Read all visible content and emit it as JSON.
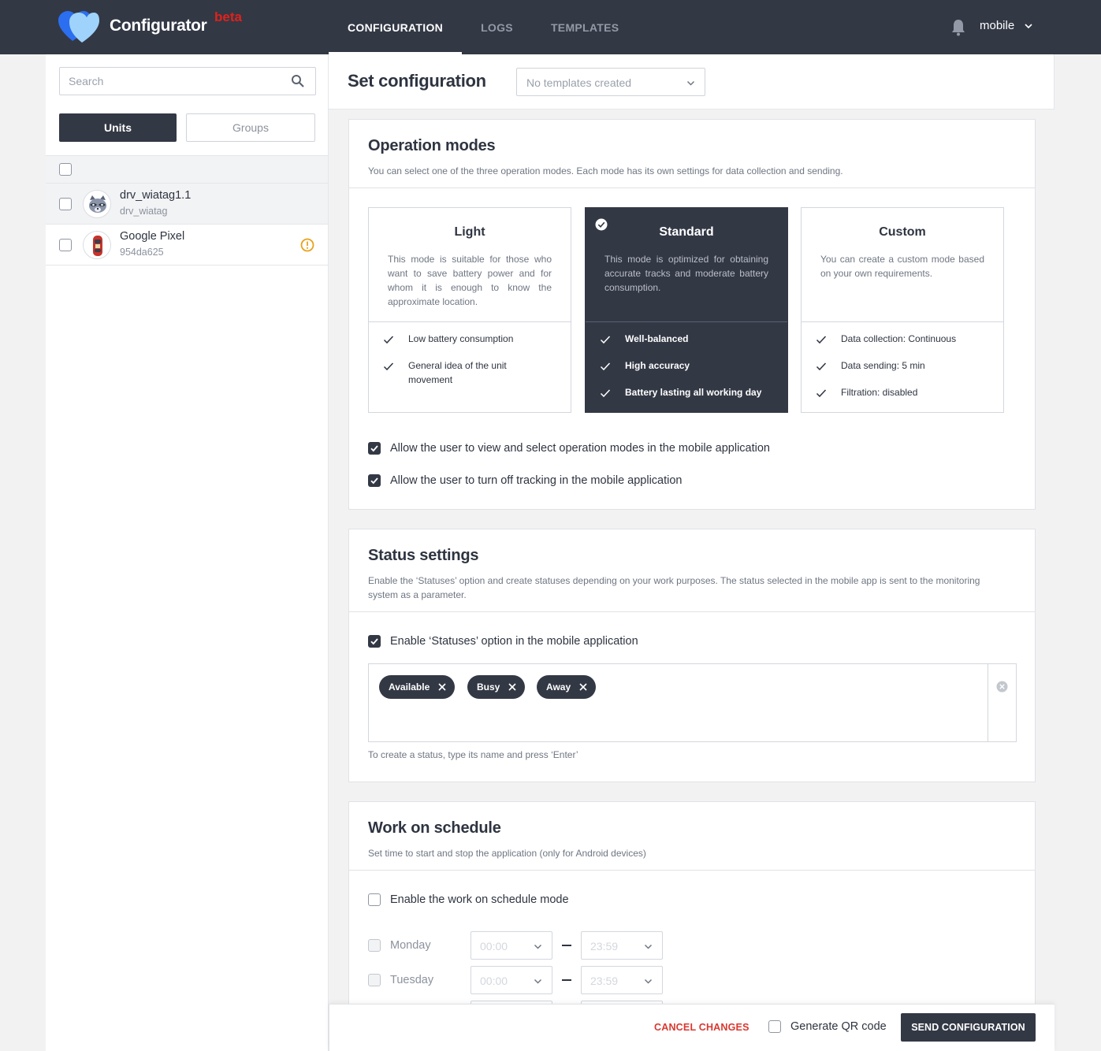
{
  "app": {
    "brand": "Configurator",
    "beta": "beta"
  },
  "nav": {
    "tabs": [
      "CONFIGURATION",
      "LOGS",
      "TEMPLATES"
    ],
    "active": 0,
    "user": "mobile"
  },
  "sidebar": {
    "search_placeholder": "Search",
    "units_label": "Units",
    "groups_label": "Groups",
    "units": [
      {
        "name": "drv_wiatag1.1",
        "sub": "drv_wiatag",
        "avatar": "raccoon-avatar"
      },
      {
        "name": "Google Pixel",
        "sub": "954da625",
        "avatar": "car-avatar",
        "warning": true
      }
    ]
  },
  "page": {
    "title": "Set configuration",
    "template_placeholder": "No templates created"
  },
  "operation": {
    "title": "Operation modes",
    "desc": "You can select one of the three operation modes. Each mode has its own settings for data collection and sending.",
    "modes": [
      {
        "title": "Light",
        "desc": "This mode is suitable for those who want to save battery power and for whom it is enough to know the approximate location.",
        "features": [
          "Low battery consumption",
          "General idea of the unit movement"
        ],
        "selected": false
      },
      {
        "title": "Standard",
        "desc": "This mode is optimized for obtaining accurate tracks and moderate battery consumption.",
        "features": [
          "Well-balanced",
          "High accuracy",
          "Battery lasting all working day"
        ],
        "selected": true
      },
      {
        "title": "Custom",
        "desc": "You can create a custom mode based on your own requirements.",
        "features": [
          "Data collection: Continuous",
          "Data sending: 5 min",
          "Filtration: disabled"
        ],
        "selected": false
      }
    ],
    "allow_select": "Allow the user to view and select operation modes in the mobile application",
    "allow_off": "Allow the user to turn off tracking in the mobile application"
  },
  "status": {
    "title": "Status settings",
    "desc": "Enable the ‘Statuses’ option and create statuses depending on your work purposes. The status selected in the mobile app is sent to the monitoring system as a parameter.",
    "enable": "Enable ‘Statuses’ option in the mobile application",
    "tags": [
      "Available",
      "Busy",
      "Away"
    ],
    "hint": "To create a status, type its name and press ‘Enter’"
  },
  "schedule": {
    "title": "Work on schedule",
    "desc": "Set time to start and stop the application (only for Android devices)",
    "enable": "Enable the work on schedule mode",
    "days": [
      {
        "name": "Monday",
        "from": "00:00",
        "to": "23:59"
      },
      {
        "name": "Tuesday",
        "from": "00:00",
        "to": "23:59"
      }
    ]
  },
  "footer": {
    "cancel": "CANCEL CHANGES",
    "qr": "Generate QR code",
    "send": "SEND CONFIGURATION"
  },
  "colors": {
    "dark": "#333845",
    "accent_red": "#e0221b",
    "warning": "#e8a21a"
  }
}
